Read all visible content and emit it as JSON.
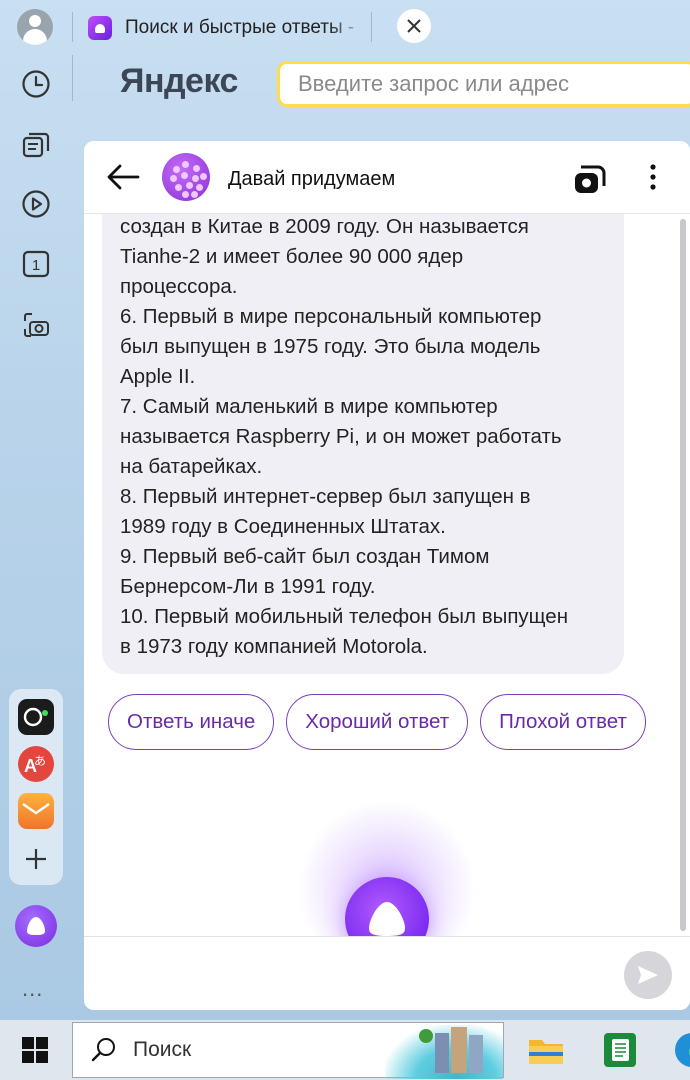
{
  "browser": {
    "tab_title": "Поиск и быстрые ответы - ",
    "logo": "Яндекс",
    "address_placeholder": "Введите запрос или адрес"
  },
  "sidebar": {
    "items": [
      {
        "name": "history",
        "icon": "clock-icon"
      },
      {
        "name": "collections",
        "icon": "cards-icon"
      },
      {
        "name": "video",
        "icon": "play-icon"
      },
      {
        "name": "tabs-counter",
        "icon": "tab-count-icon",
        "label": "1"
      },
      {
        "name": "screenshot",
        "icon": "camera-icon"
      }
    ],
    "extensions": [
      {
        "name": "screen-recorder",
        "color": "#1b1b1b"
      },
      {
        "name": "translator",
        "color": "#e2463c"
      },
      {
        "name": "mail",
        "color": "#f39c1a"
      }
    ],
    "more": "..."
  },
  "chat": {
    "bot_name": "Давай придумаем",
    "message_lines": [
      "создан в Китае в 2009 году. Он называется",
      "Tianhe-2 и имеет более 90 000 ядер",
      "процессора.",
      "6. Первый в мире персональный компьютер",
      "был выпущен в 1975 году. Это была модель",
      "Apple II.",
      "7. Самый маленький в мире компьютер",
      "называется Raspberry Pi, и он может работать",
      "на батарейках.",
      "8. Первый интернет-сервер был запущен в",
      "1989 году в Соединенных Штатах.",
      "9. Первый веб-сайт был создан Тимом",
      "Бернерсом-Ли в 1991 году.",
      "10. Первый мобильный телефон был выпущен",
      "в 1973 году компанией Motorola."
    ],
    "suggestions": [
      "Ответь иначе",
      "Хороший ответ",
      "Плохой ответ"
    ],
    "input_placeholder": "",
    "accent_color": "#7a2de0"
  },
  "taskbar": {
    "search_label": "Поиск"
  }
}
